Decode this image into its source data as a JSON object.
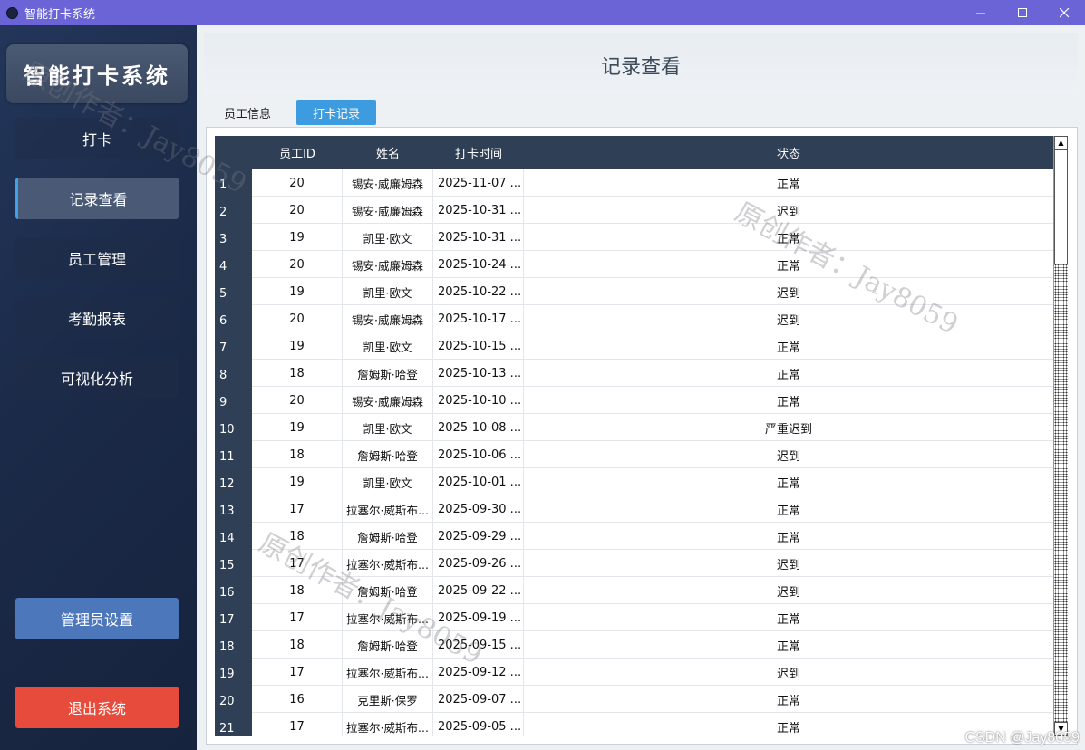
{
  "window": {
    "title": "智能打卡系统",
    "controls": [
      "—",
      "☐",
      "✕"
    ]
  },
  "sidebar": {
    "logo": "智能打卡系统",
    "items": [
      {
        "label": "打卡"
      },
      {
        "label": "记录查看"
      },
      {
        "label": "员工管理"
      },
      {
        "label": "考勤报表"
      },
      {
        "label": "可视化分析"
      }
    ],
    "active_index": 1,
    "admin_label": "管理员设置",
    "exit_label": "退出系统"
  },
  "main": {
    "page_title": "记录查看",
    "tabs": [
      {
        "label": "员工信息"
      },
      {
        "label": "打卡记录"
      }
    ],
    "active_tab": 1,
    "table": {
      "columns": [
        "员工ID",
        "姓名",
        "打卡时间",
        "状态"
      ],
      "rows": [
        {
          "n": "1",
          "id": "20",
          "name": "锡安·威廉姆森",
          "time": "2025-11-07 ...",
          "status": "正常"
        },
        {
          "n": "2",
          "id": "20",
          "name": "锡安·威廉姆森",
          "time": "2025-10-31 ...",
          "status": "迟到"
        },
        {
          "n": "3",
          "id": "19",
          "name": "凯里·欧文",
          "time": "2025-10-31 ...",
          "status": "正常"
        },
        {
          "n": "4",
          "id": "20",
          "name": "锡安·威廉姆森",
          "time": "2025-10-24 ...",
          "status": "正常"
        },
        {
          "n": "5",
          "id": "19",
          "name": "凯里·欧文",
          "time": "2025-10-22 ...",
          "status": "迟到"
        },
        {
          "n": "6",
          "id": "20",
          "name": "锡安·威廉姆森",
          "time": "2025-10-17 ...",
          "status": "迟到"
        },
        {
          "n": "7",
          "id": "19",
          "name": "凯里·欧文",
          "time": "2025-10-15 ...",
          "status": "正常"
        },
        {
          "n": "8",
          "id": "18",
          "name": "詹姆斯·哈登",
          "time": "2025-10-13 ...",
          "status": "正常"
        },
        {
          "n": "9",
          "id": "20",
          "name": "锡安·威廉姆森",
          "time": "2025-10-10 ...",
          "status": "正常"
        },
        {
          "n": "10",
          "id": "19",
          "name": "凯里·欧文",
          "time": "2025-10-08 ...",
          "status": "严重迟到"
        },
        {
          "n": "11",
          "id": "18",
          "name": "詹姆斯·哈登",
          "time": "2025-10-06 ...",
          "status": "迟到"
        },
        {
          "n": "12",
          "id": "19",
          "name": "凯里·欧文",
          "time": "2025-10-01 ...",
          "status": "正常"
        },
        {
          "n": "13",
          "id": "17",
          "name": "拉塞尔·威斯布...",
          "time": "2025-09-30 ...",
          "status": "正常"
        },
        {
          "n": "14",
          "id": "18",
          "name": "詹姆斯·哈登",
          "time": "2025-09-29 ...",
          "status": "正常"
        },
        {
          "n": "15",
          "id": "17",
          "name": "拉塞尔·威斯布...",
          "time": "2025-09-26 ...",
          "status": "迟到"
        },
        {
          "n": "16",
          "id": "18",
          "name": "詹姆斯·哈登",
          "time": "2025-09-22 ...",
          "status": "迟到"
        },
        {
          "n": "17",
          "id": "17",
          "name": "拉塞尔·威斯布...",
          "time": "2025-09-19 ...",
          "status": "正常"
        },
        {
          "n": "18",
          "id": "18",
          "name": "詹姆斯·哈登",
          "time": "2025-09-15 ...",
          "status": "正常"
        },
        {
          "n": "19",
          "id": "17",
          "name": "拉塞尔·威斯布...",
          "time": "2025-09-12 ...",
          "status": "迟到"
        },
        {
          "n": "20",
          "id": "16",
          "name": "克里斯·保罗",
          "time": "2025-09-07 ...",
          "status": "正常"
        },
        {
          "n": "21",
          "id": "17",
          "name": "拉塞尔·威斯布...",
          "time": "2025-09-05 ...",
          "status": "正常"
        }
      ]
    }
  },
  "watermarks": [
    "原创作者：Jay8059",
    "原创作者：Jay8059",
    "原创作者：Jay8059"
  ],
  "footer_mark": "CSDN @Jay8059",
  "colors": {
    "titlebar": "#6a64d6",
    "sidebar": "#1b2a48",
    "accent_tab": "#3d9be0",
    "admin_button": "#4d77bb",
    "exit_button": "#e64b3c",
    "table_header": "#2f3f55"
  }
}
